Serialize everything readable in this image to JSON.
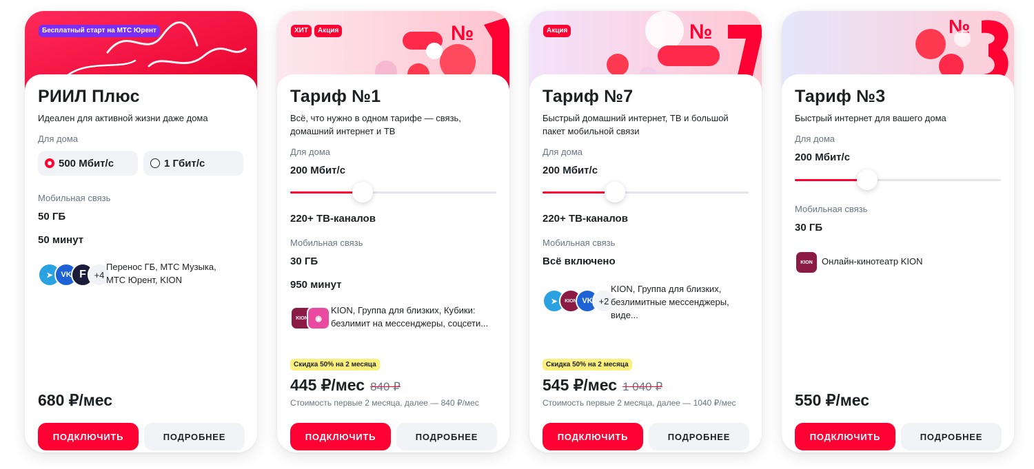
{
  "colors": {
    "accent": "#ff0032",
    "promo": "#fdf07c",
    "muted": "#6b7480"
  },
  "cards": [
    {
      "badge": "Бесплатный старт на МТС Юрент",
      "title": "РИИЛ Плюс",
      "description": "Идеален для активной жизни даже дома",
      "home_label": "Для дома",
      "speed_options": [
        "500 Мбит/с",
        "1 Гбит/с"
      ],
      "speed_selected": "500 Мбит/с",
      "mobile_label": "Мобильная связь",
      "data": "50 ГБ",
      "minutes": "50 минут",
      "extras_icons": [
        "telegram-icon",
        "vk-icon",
        "yurent-icon"
      ],
      "extras_more": "+4",
      "extras_text": "Перенос ГБ, МТС Музыка, МТС Юрент, KION",
      "price": "680 ₽/мес",
      "connect_label": "ПОДКЛЮЧИТЬ",
      "details_label": "ПОДРОБНЕЕ"
    },
    {
      "badges": [
        "ХИТ",
        "Акция"
      ],
      "title": "Тариф №1",
      "description": "Всё, что нужно в одном тарифе — связь, домашний интернет и ТВ",
      "home_label": "Для дома",
      "speed": "200 Мбит/с",
      "slider_level": 0.35,
      "tv": "220+ ТВ-каналов",
      "mobile_label": "Мобильная связь",
      "data": "30 ГБ",
      "minutes": "950 минут",
      "extras_icons": [
        "kion-icon",
        "kubiki-icon"
      ],
      "extras_text": "KION, Группа для близких, Кубики: безлимит на мессенджеры, соцсети...",
      "promo": "Скидка 50% на 2 месяца",
      "price": "445 ₽/мес",
      "old_price": "840 ₽",
      "price_note": "Стоимость первые 2 месяца, далее — 840 ₽/мес",
      "connect_label": "ПОДКЛЮЧИТЬ",
      "details_label": "ПОДРОБНЕЕ"
    },
    {
      "badges": [
        "Акция"
      ],
      "title": "Тариф №7",
      "description": "Быстрый домашний интернет, ТВ и большой пакет мобильной связи",
      "home_label": "Для дома",
      "speed": "200 Мбит/с",
      "slider_level": 0.35,
      "tv": "220+ ТВ-каналов",
      "mobile_label": "Мобильная связь",
      "mobile_value": "Всё включено",
      "extras_icons": [
        "telegram-icon",
        "kion-icon",
        "vk-icon"
      ],
      "extras_more": "+2",
      "extras_text": "KION, Группа для близких, безлимитные мессенджеры, виде...",
      "promo": "Скидка 50% на 2 месяца",
      "price": "545 ₽/мес",
      "old_price": "1 040 ₽",
      "price_note": "Стоимость первые 2 месяца, далее — 1040 ₽/мес",
      "connect_label": "ПОДКЛЮЧИТЬ",
      "details_label": "ПОДРОБНЕЕ"
    },
    {
      "title": "Тариф №3",
      "description": "Быстрый интернет для вашего дома",
      "home_label": "Для дома",
      "speed": "200 Мбит/с",
      "slider_level": 0.35,
      "mobile_label": "Мобильная связь",
      "data": "30 ГБ",
      "extras_icons": [
        "kion-icon"
      ],
      "extras_text": "Онлайн-кинотеатр KION",
      "price": "550 ₽/мес",
      "connect_label": "ПОДКЛЮЧИТЬ",
      "details_label": "ПОДРОБНЕЕ"
    }
  ]
}
